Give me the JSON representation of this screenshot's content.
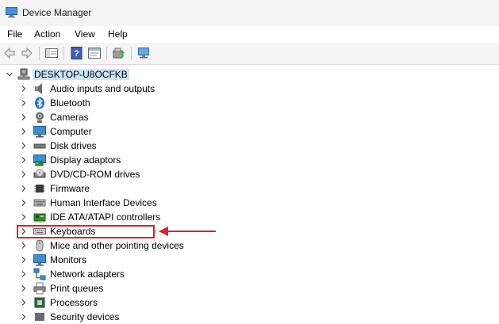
{
  "window": {
    "title": "Device Manager"
  },
  "menu": [
    "File",
    "Action",
    "View",
    "Help"
  ],
  "tree": {
    "root": "DESKTOP-U8OCFKB",
    "items": [
      {
        "label": "Audio inputs and outputs",
        "icon": "speaker-icon"
      },
      {
        "label": "Bluetooth",
        "icon": "bluetooth-icon"
      },
      {
        "label": "Cameras",
        "icon": "camera-icon"
      },
      {
        "label": "Computer",
        "icon": "monitor-icon"
      },
      {
        "label": "Disk drives",
        "icon": "disk-drive-icon"
      },
      {
        "label": "Display adaptors",
        "icon": "display-adapter-icon"
      },
      {
        "label": "DVD/CD-ROM drives",
        "icon": "dvd-drive-icon"
      },
      {
        "label": "Firmware",
        "icon": "chip-icon"
      },
      {
        "label": "Human Interface Devices",
        "icon": "hid-icon"
      },
      {
        "label": "IDE ATA/ATAPI controllers",
        "icon": "controller-card-icon"
      },
      {
        "label": "Keyboards",
        "icon": "keyboard-icon"
      },
      {
        "label": "Mice and other pointing devices",
        "icon": "mouse-icon"
      },
      {
        "label": "Monitors",
        "icon": "monitor-icon"
      },
      {
        "label": "Network adapters",
        "icon": "network-icon"
      },
      {
        "label": "Print queues",
        "icon": "printer-icon"
      },
      {
        "label": "Processors",
        "icon": "processor-icon"
      },
      {
        "label": "Security devices",
        "icon": "security-chip-icon"
      }
    ]
  },
  "annotation": {
    "color": "#d0262b",
    "highlighted_item": "Keyboards"
  }
}
